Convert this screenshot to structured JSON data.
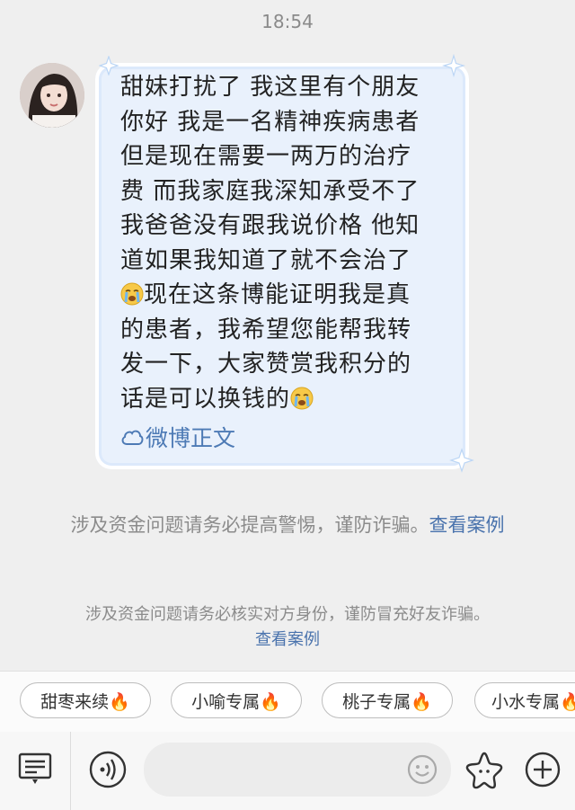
{
  "status": {
    "time": "18:54"
  },
  "message": {
    "sender_avatar": "avatar",
    "lines": [
      "甜妹打扰了 我这里有个朋友",
      "你好 我是一名精神疾病患者",
      "但是现在需要一两万的治疗",
      "费 而我家庭我深知承受不了",
      "我爸爸没有跟我说价格 他知",
      "道如果我知道了就不会治了"
    ],
    "line7_rest": "现在这条博能证明我是真",
    "line8": "的患者，我希望您能帮我转",
    "line9": "发一下，大家赞赏我积分的",
    "line10": "话是可以换钱的",
    "emoji_name": "crying-emoji",
    "weibo_link": "微博正文"
  },
  "notices": {
    "notice1_text": "涉及资金问题请务必提高警惕，谨防诈骗。",
    "notice1_link": "查看案例",
    "notice2_text": "涉及资金问题请务必核实对方身份，谨防冒充好友诈骗。",
    "notice2_link": "查看案例"
  },
  "chips": [
    "甜枣来续🔥",
    "小喻专属🔥",
    "桃子专属🔥",
    "小水专属🔥"
  ],
  "input": {
    "placeholder": ""
  },
  "colors": {
    "link": "#4a73ad",
    "bubble_bg": "#e9f1fc",
    "bg": "#efefef"
  }
}
